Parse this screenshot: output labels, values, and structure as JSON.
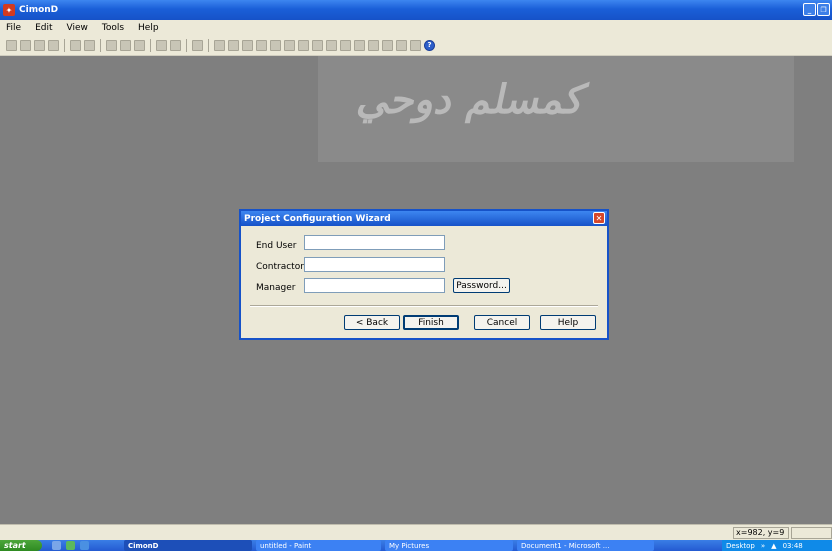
{
  "window": {
    "title": "CimonD"
  },
  "menu": [
    "File",
    "Edit",
    "View",
    "Tools",
    "Help"
  ],
  "dialog": {
    "title": "Project Configuration Wizard",
    "fields": [
      {
        "label": "End User",
        "value": ""
      },
      {
        "label": "Contractor",
        "value": ""
      },
      {
        "label": "Manager",
        "value": ""
      }
    ],
    "password_button": "Password...",
    "buttons": {
      "back": "< Back",
      "finish": "Finish",
      "cancel": "Cancel",
      "help": "Help"
    }
  },
  "statusbar": {
    "coordinates": "x=982, y=9"
  },
  "taskbar": {
    "start": "start",
    "tasks": [
      "CimonD",
      "untitled - Paint",
      "My Pictures",
      "Document1 - Microsoft ..."
    ],
    "tray_desktop": "Desktop",
    "clock": "03:48"
  }
}
